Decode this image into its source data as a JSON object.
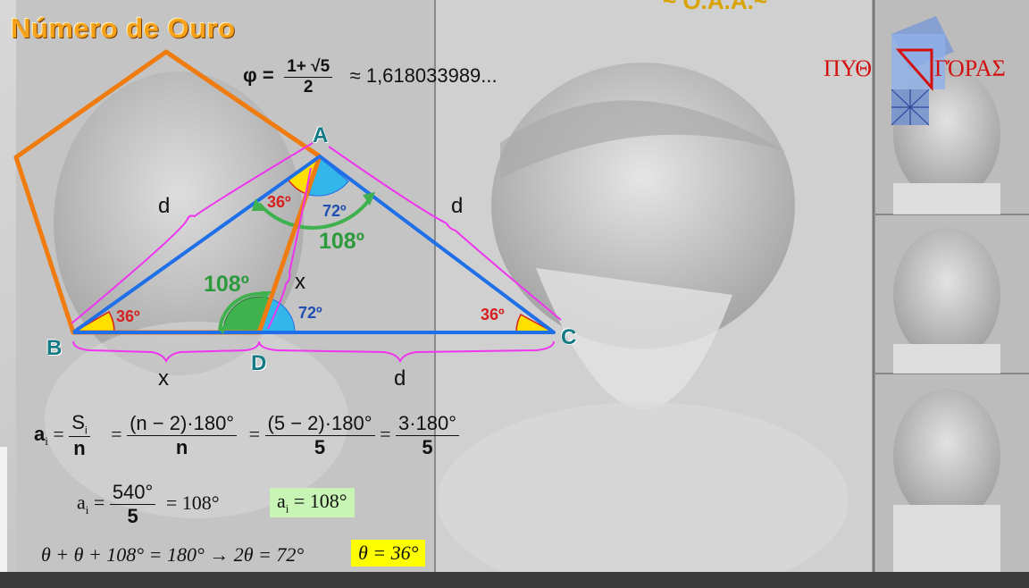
{
  "title": "Número de Ouro",
  "corner_text": "~ O.A.A.~",
  "logo": {
    "text_left": "ΠΥΘ",
    "text_right": "ΓΌΡΑΣ"
  },
  "phi_formula": {
    "lhs": "φ =",
    "numerator": "1+ √5",
    "denominator": "2",
    "approx": "≈ 1,618033989..."
  },
  "points": {
    "A": "A",
    "B": "B",
    "C": "C",
    "D": "D"
  },
  "lengths": {
    "d_left": "d",
    "d_right": "d",
    "x_mid": "x",
    "x_bottom": "x",
    "d_bottom": "d"
  },
  "angles": {
    "a_36": "36º",
    "a_72": "72º",
    "a_108_top": "108º",
    "b_36": "36º",
    "d_108": "108º",
    "d_72": "72º",
    "c_36": "36º"
  },
  "equations": {
    "line1": {
      "lhs": "a",
      "lhs_sub": "i",
      "f1_num": "S",
      "f1_num_sub": "i",
      "f1_den": "n",
      "eq": "=",
      "f2_num": "(n − 2)·180°",
      "f2_den": "n",
      "f3_num": "(5 − 2)·180°",
      "f3_den": "5",
      "f4_num": "3·180°",
      "f4_den": "5"
    },
    "line2": {
      "lhs": "a",
      "lhs_sub": "i",
      "f_num": "540°",
      "f_den": "5",
      "rhs": "= 108°",
      "box_lhs": "a",
      "box_sub": "i",
      "box_rhs": "= 108°"
    },
    "line3": {
      "text": "θ + θ + 108° = 180° → 2θ = 72°",
      "box": "θ = 36°"
    }
  },
  "colors": {
    "orange": "#f07c10",
    "blue": "#1f6fe8",
    "magenta": "#ef35ef",
    "green": "#3fb24f",
    "yellow": "#ffe000",
    "cyan": "#33b6ea",
    "red": "#d62020",
    "teal": "#137a86"
  }
}
